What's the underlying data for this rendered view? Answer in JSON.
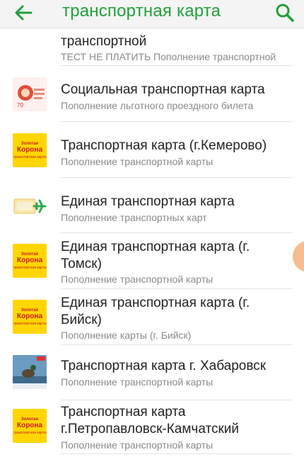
{
  "appbar": {
    "title": "транспортная карта"
  },
  "partial_item": {
    "title": "транспортной",
    "subtitle": "ТЕСТ НЕ ПЛАТИТЬ Пополнение транспортной"
  },
  "items": [
    {
      "title_line1": "Социальная транспортная карта",
      "title_line2": "",
      "subtitle": "Пополнение льготного проездного билета"
    },
    {
      "title_line1": "Транспортная карта (г.Кемерово)",
      "title_line2": "",
      "subtitle": "Пополнение транспортной карты"
    },
    {
      "title_line1": "Единая транспортная карта",
      "title_line2": "",
      "subtitle": "Пополнение транспортных карт"
    },
    {
      "title_line1": "Единая транспортная карта (г.",
      "title_line2": "Томск)",
      "subtitle": "Пополнение транспортной карты"
    },
    {
      "title_line1": "Единая транспортная карта (г.",
      "title_line2": "Бийск)",
      "subtitle": "Пополнение карты (г. Бийск)"
    },
    {
      "title_line1": "Транспортная карта г. Хабаровск",
      "title_line2": "",
      "subtitle": "Пополнение транспортной карты"
    },
    {
      "title_line1": "Транспортная карта",
      "title_line2": "г.Петропавловск-Камчатский",
      "subtitle": "Пополнение транспортной карты"
    }
  ],
  "korona_logo": {
    "line1": "Золотая",
    "line2": "Корона",
    "line3": "транспортная карта"
  },
  "colors": {
    "accent": "#21a038",
    "korona_bg": "#ffd600",
    "korona_text": "#c81d25"
  }
}
